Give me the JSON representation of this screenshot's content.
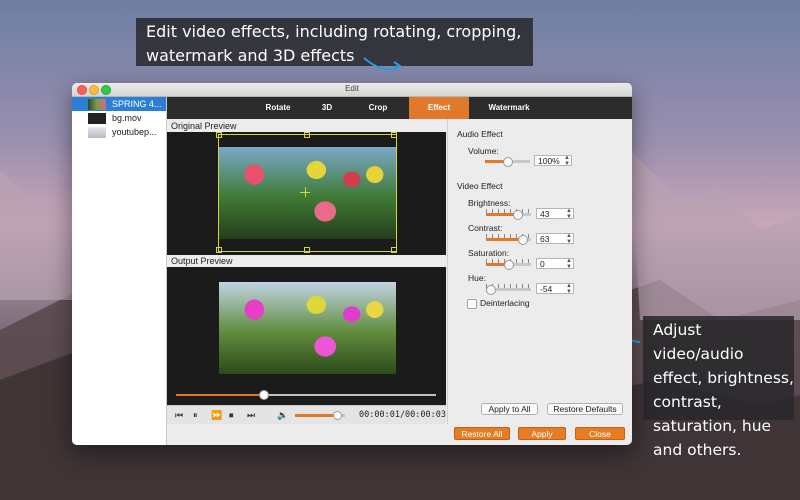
{
  "callouts": {
    "top": "Edit video effects, including rotating, cropping, watermark and 3D effects",
    "right": "Adjust video/audio effect, brightness, contrast, saturation, hue and others."
  },
  "window": {
    "title": "Edit"
  },
  "files": [
    {
      "name": "SPRING 4...",
      "thumb": "tulips-thumbnail",
      "selected": true
    },
    {
      "name": "bg.mov",
      "thumb": "dark-thumbnail",
      "selected": false
    },
    {
      "name": "youtubep...",
      "thumb": "document-thumbnail",
      "selected": false
    }
  ],
  "tabs": [
    {
      "label": "Rotate",
      "active": false
    },
    {
      "label": "3D",
      "active": false
    },
    {
      "label": "Crop",
      "active": false
    },
    {
      "label": "Effect",
      "active": true
    },
    {
      "label": "Watermark",
      "active": false
    }
  ],
  "preview": {
    "original_label": "Original Preview",
    "output_label": "Output Preview",
    "position_fraction": 0.34
  },
  "player": {
    "time": "00:00:01/00:00:03",
    "volume_fraction": 0.85,
    "icons": [
      "skip-back-icon",
      "pause-icon",
      "fast-forward-icon",
      "stop-icon",
      "skip-forward-icon",
      "speaker-icon"
    ]
  },
  "audio": {
    "section": "Audio Effect",
    "volume_label": "Volume:",
    "volume_value": "100%",
    "volume_fraction": 0.5
  },
  "video": {
    "section": "Video Effect",
    "brightness_label": "Brightness:",
    "brightness_value": "43",
    "brightness_fraction": 0.72,
    "contrast_label": "Contrast:",
    "contrast_value": "63",
    "contrast_fraction": 0.82,
    "saturation_label": "Saturation:",
    "saturation_value": "0",
    "saturation_fraction": 0.5,
    "hue_label": "Hue:",
    "hue_value": "-54",
    "hue_fraction": 0.1,
    "deinterlacing_label": "Deinterlacing",
    "deinterlacing_checked": false
  },
  "buttons": {
    "apply_to_all": "Apply to All",
    "restore_defaults": "Restore Defaults",
    "restore_all": "Restore All",
    "apply": "Apply",
    "close": "Close"
  },
  "colors": {
    "accent": "#e07a2a",
    "selection": "#2d7fd6",
    "crop_guide": "#d6d63a"
  }
}
